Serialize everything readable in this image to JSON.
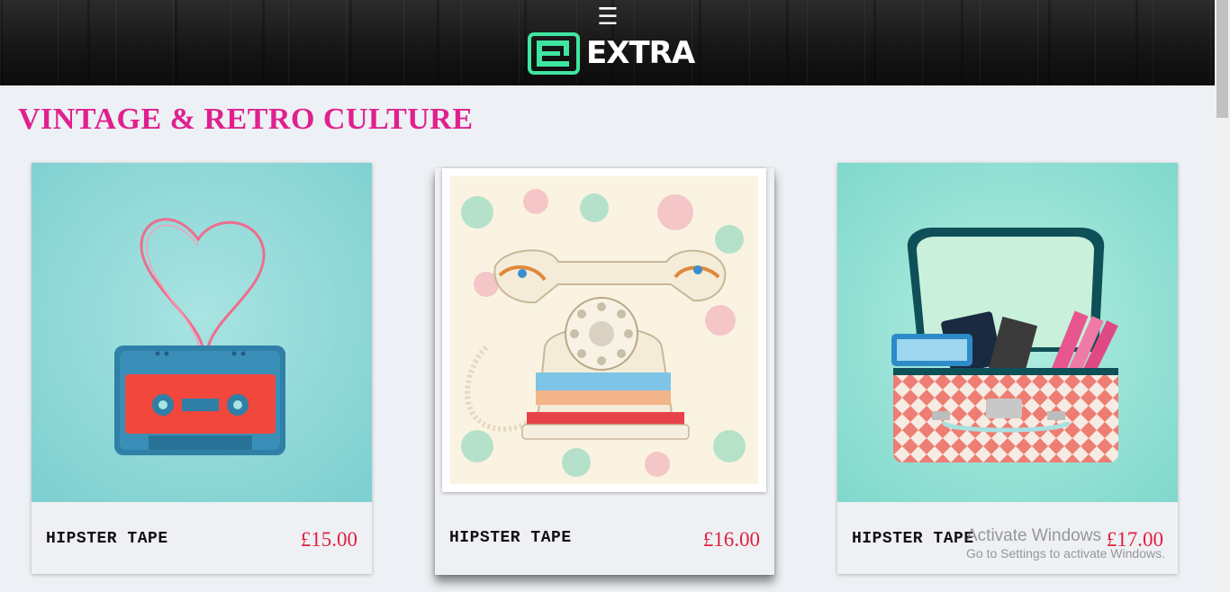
{
  "header": {
    "menu_icon": "☰",
    "logo_text": "EXTRA"
  },
  "page_title": "VINTAGE & RETRO CULTURE",
  "products": [
    {
      "name": "HIPSTER TAPE",
      "price": "£15.00",
      "image": "cassette-tape-heart"
    },
    {
      "name": "HIPSTER TAPE",
      "price": "£16.00",
      "image": "vintage-rotary-telephone"
    },
    {
      "name": "HIPSTER TAPE",
      "price": "£17.00",
      "image": "retro-suitcase"
    }
  ],
  "watermark": {
    "title": "Activate Windows",
    "subtitle": "Go to Settings to activate Windows."
  },
  "colors": {
    "title": "#e0208f",
    "price": "#e01f3d",
    "logo_accent": "#3fe6a0",
    "page_bg": "#edf0f4"
  }
}
